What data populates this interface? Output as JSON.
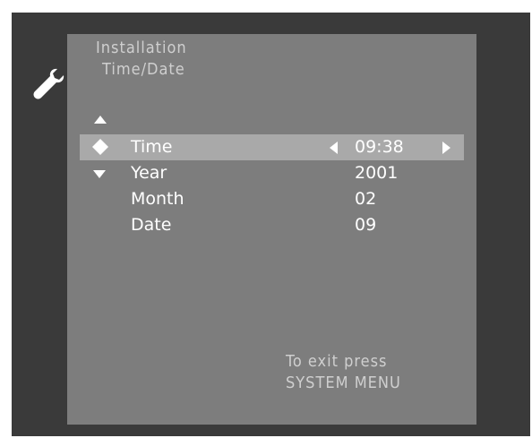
{
  "icons": {
    "tool": "wrench-icon",
    "scroll_up": "triangle-up-icon",
    "scroll_down": "triangle-down-icon",
    "selector": "diamond-selector-icon",
    "value_decrease": "triangle-left-icon",
    "value_increase": "triangle-right-icon"
  },
  "colors": {
    "screen_background": "#3a3a3a",
    "panel_background": "#7d7d7d",
    "selected_row": "#a9a9a9",
    "text_primary": "#ffffff",
    "text_secondary": "#cfcfcf"
  },
  "breadcrumb": {
    "level1": "Installation",
    "level2": "Time/Date"
  },
  "menu": {
    "items": [
      {
        "label": "Time",
        "value": "09:38",
        "selected": true
      },
      {
        "label": "Year",
        "value": "2001",
        "selected": false
      },
      {
        "label": "Month",
        "value": "02",
        "selected": false
      },
      {
        "label": "Date",
        "value": "09",
        "selected": false
      }
    ]
  },
  "footer": {
    "exit_line1": "To exit press",
    "exit_line2": "SYSTEM MENU"
  }
}
